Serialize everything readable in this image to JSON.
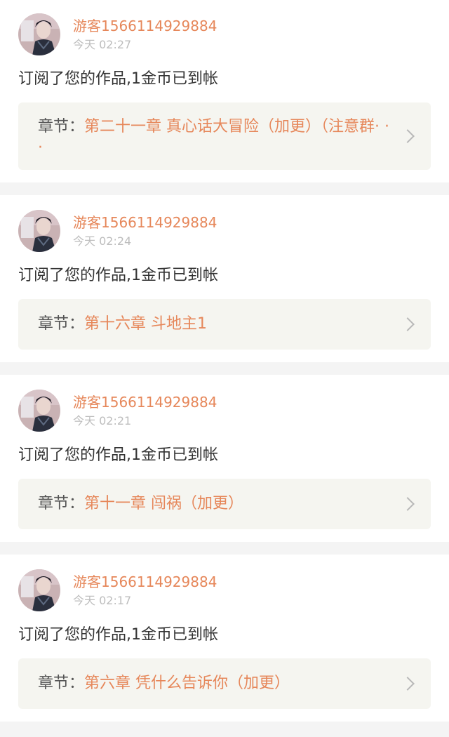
{
  "notifications": [
    {
      "username": "游客1566114929884",
      "time": "今天 02:27",
      "message": "订阅了您的作品,1金币已到帐",
      "chapter_prefix": "章节：",
      "chapter_title": "第二十一章 真心话大冒险（加更）（注意群· · ·"
    },
    {
      "username": "游客1566114929884",
      "time": "今天 02:24",
      "message": "订阅了您的作品,1金币已到帐",
      "chapter_prefix": "章节：",
      "chapter_title": "第十六章 斗地主1"
    },
    {
      "username": "游客1566114929884",
      "time": "今天 02:21",
      "message": "订阅了您的作品,1金币已到帐",
      "chapter_prefix": "章节：",
      "chapter_title": "第十一章 闯祸（加更）"
    },
    {
      "username": "游客1566114929884",
      "time": "今天 02:17",
      "message": "订阅了您的作品,1金币已到帐",
      "chapter_prefix": "章节：",
      "chapter_title": "第六章 凭什么告诉你（加更）"
    }
  ],
  "colors": {
    "accent": "#e6875a",
    "text": "#333333",
    "muted": "#bdbdbd",
    "chapter_bg": "#f5f5f0",
    "page_bg": "#f4f4f4"
  },
  "icons": {
    "avatar": "user-avatar",
    "chevron": "chevron-right-icon"
  }
}
